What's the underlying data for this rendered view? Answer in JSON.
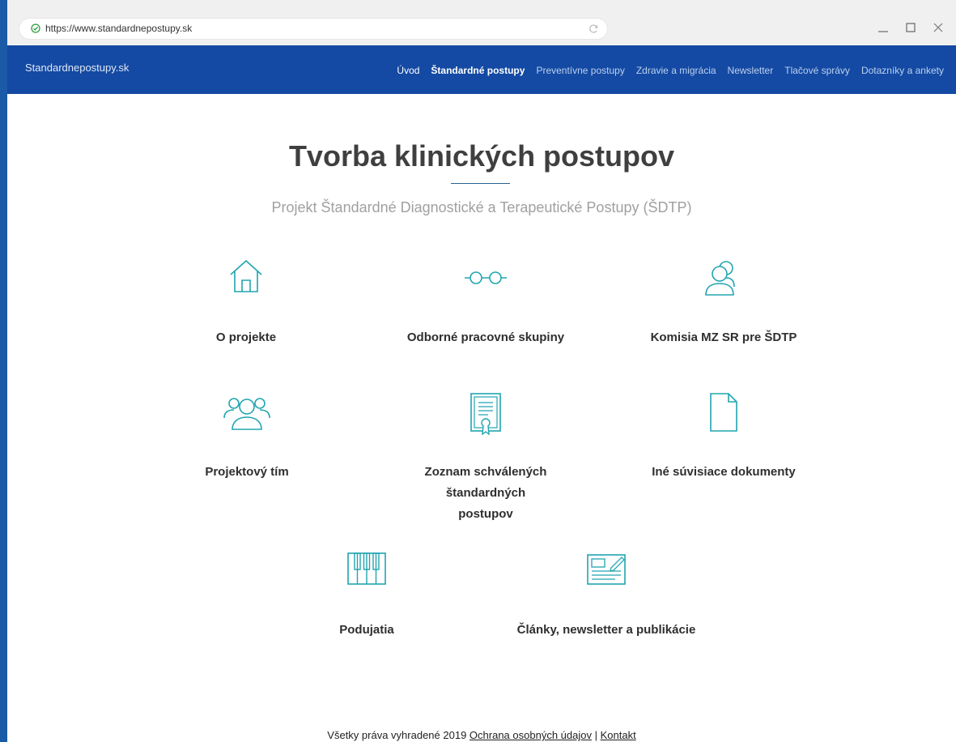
{
  "browser": {
    "url": "https://www.standardnepostupy.sk"
  },
  "nav": {
    "brand": "Standardnepostupy.sk",
    "items": [
      {
        "label": "Úvod"
      },
      {
        "label": "Štandardné postupy"
      },
      {
        "label": "Preventívne postupy"
      },
      {
        "label": "Zdravie a migrácia"
      },
      {
        "label": "Newsletter"
      },
      {
        "label": "Tlačové správy"
      },
      {
        "label": "Dotazníky a ankety"
      }
    ]
  },
  "main": {
    "title": "Tvorba klinických postupov",
    "subtitle": "Projekt Štandardné Diagnostické a Terapeutické Postupy (ŠDTP)",
    "cards": [
      {
        "label": "O projekte",
        "icon": "home-icon"
      },
      {
        "label": "Odborné pracovné skupiny",
        "icon": "glasses-icon"
      },
      {
        "label": "Komisia MZ SR pre ŠDTP",
        "icon": "users-icon"
      },
      {
        "label": "Projektový tím",
        "icon": "team-icon"
      },
      {
        "label": "Zoznam schválených štandardných postupov",
        "icon": "certificate-icon"
      },
      {
        "label": "Iné súvisiace dokumenty",
        "icon": "document-icon"
      },
      {
        "label": "Podujatia",
        "icon": "piano-icon"
      },
      {
        "label": "Články, newsletter a publikácie",
        "icon": "newspaper-icon"
      }
    ]
  },
  "footer": {
    "text": "Všetky práva vyhradené 2019",
    "privacy": "Ochrana osobných údajov",
    "separator": "|",
    "contact": "Kontakt"
  },
  "colors": {
    "accent": "#20a5b0",
    "navbar": "#144aa3"
  }
}
